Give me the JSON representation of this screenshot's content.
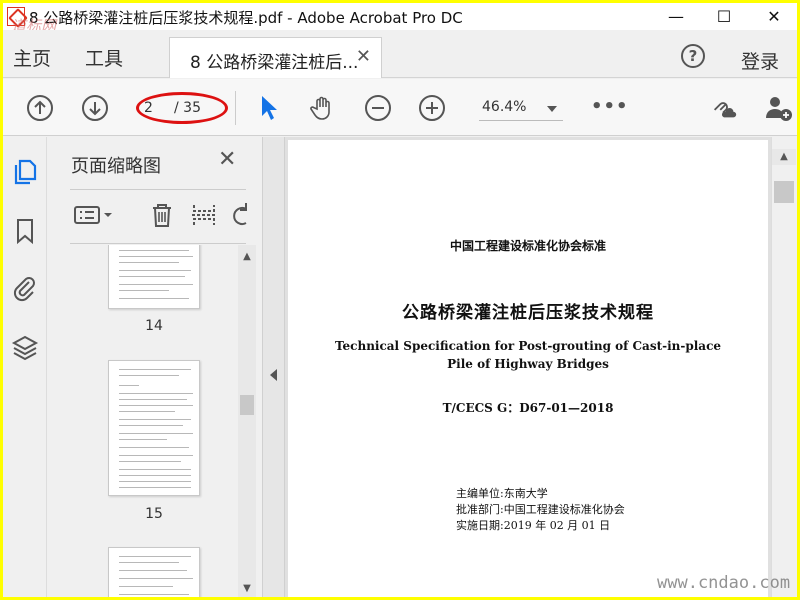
{
  "window": {
    "title": "8 公路桥梁灌注桩后压浆技术规程.pdf - Adobe Acrobat Pro DC",
    "watermark_top": "道标网",
    "minimize_glyph": "—",
    "maximize_glyph": "☐",
    "close_glyph": "✕"
  },
  "menu": {
    "home": "主页",
    "tools": "工具",
    "tab_label": "8 公路桥梁灌注桩后...",
    "tab_close": "✕",
    "help_glyph": "?",
    "login": "登录"
  },
  "toolbar": {
    "current_page": "2",
    "total_pages": "/ 35",
    "zoom": "46.4%",
    "more": "•••"
  },
  "panel": {
    "title": "页面缩略图",
    "close_glyph": "✕",
    "thumbnails": [
      {
        "label": "14"
      },
      {
        "label": "15"
      }
    ]
  },
  "document": {
    "org": "中国工程建设标准化协会标准",
    "title_cn": "公路桥梁灌注桩后压浆技术规程",
    "title_en_1": "Technical Specification for Post-grouting of Cast-in-place",
    "title_en_2": "Pile of Highway Bridges",
    "code": "T/CECS G：D67-01—2018",
    "editor": "主编单位:东南大学",
    "approver": "批准部门:中国工程建设标准化协会",
    "date": "实施日期:2019 年 02 月 01 日"
  },
  "watermark_bottom": "www.cndao.com",
  "colors": {
    "border": "#ffff00",
    "annotation": "#dd1111",
    "icon_blue": "#1473e6"
  }
}
